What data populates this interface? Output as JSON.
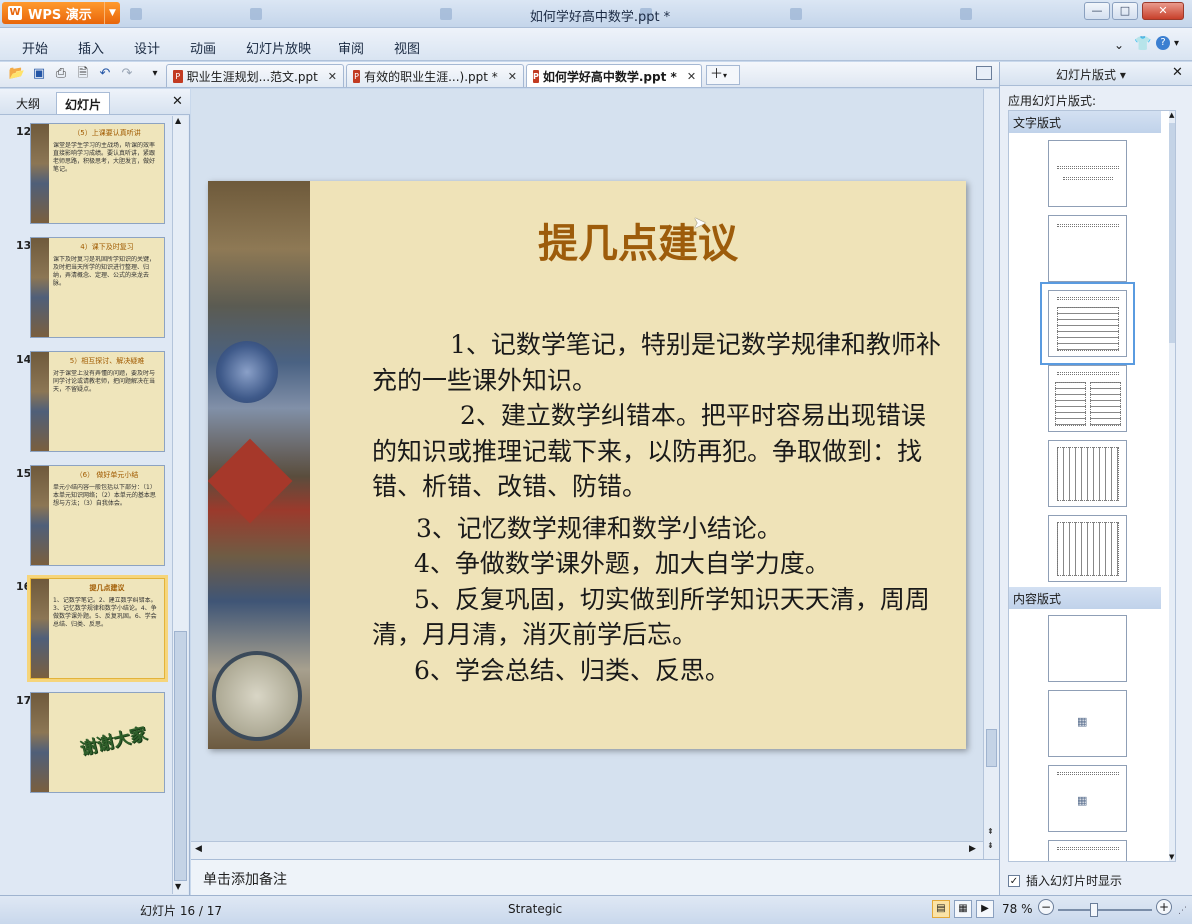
{
  "app": {
    "name": "WPS 演示",
    "window_title": "如何学好高中数学.ppt *"
  },
  "window_controls": {
    "minimize": "—",
    "maximize": "□",
    "close": "✕"
  },
  "menu": [
    "开始",
    "插入",
    "设计",
    "动画",
    "幻灯片放映",
    "审阅",
    "视图"
  ],
  "doc_tabs": [
    {
      "label": "职业生涯规划...范文.ppt",
      "active": false
    },
    {
      "label": "有效的职业生涯...).ppt *",
      "active": false
    },
    {
      "label": "如何学好高中数学.ppt *",
      "active": true
    }
  ],
  "left_panel": {
    "tabs": [
      "大纲",
      "幻灯片"
    ],
    "active_tab": "幻灯片",
    "close": "✕",
    "thumbnails": [
      {
        "num": "12",
        "title": "（5）上课要认真听讲",
        "text": "课堂是学生学习的主战场，听课的效率直接影响学习成绩。要认真听讲，紧跟老师思路，积极思考，大胆发言，做好笔记。"
      },
      {
        "num": "13",
        "title": "4）课下及时复习",
        "text": "课下及时复习是巩固所学知识的关键，及时把当天所学的知识进行整理、归纳，弄清概念、定理、公式的来龙去脉。"
      },
      {
        "num": "14",
        "title": "5）相互探讨、解决疑难",
        "text": "对于课堂上没有弄懂的问题，要及时与同学讨论或请教老师，把问题解决在当天，不留疑点。"
      },
      {
        "num": "15",
        "title": "（6） 做好单元小结",
        "text": "单元小结内容一般包括以下部分：（1）本单元知识网络；（2）本单元的基本思想与方法；（3）自我体会。"
      },
      {
        "num": "16",
        "title": "提几点建议",
        "text": "1、记数学笔记。2、建立数学纠错本。3、记忆数学规律和数学小结论。4、争做数学课外题。5、反复巩固。6、学会总结、归类、反思。",
        "selected": true
      },
      {
        "num": "17",
        "title": "",
        "text": "谢谢大家",
        "art": true
      }
    ]
  },
  "slide": {
    "title": "提几点建议",
    "paragraphs": [
      "1、记数学笔记，特别是记数学规律和教师补充的一些课外知识。",
      "2、建立数学纠错本。把平时容易出现错误的知识或推理记载下来，以防再犯。争取做到：找错、析错、改错、防错。",
      "3、记忆数学规律和数学小结论。",
      "4、争做数学课外题，加大自学力度。",
      "5、反复巩固，切实做到所学知识天天清，周周清，月月清，消灭前学后忘。",
      "6、学会总结、归类、反思。"
    ]
  },
  "notes_placeholder": "单击添加备注",
  "right_pane": {
    "title": "幻灯片版式",
    "apply_label": "应用幻灯片版式:",
    "section_text": "文字版式",
    "section_content": "内容版式",
    "checkbox_label": "插入幻灯片时显示",
    "checkbox_checked": true
  },
  "status": {
    "slide_counter": "幻灯片 16 / 17",
    "theme": "Strategic",
    "zoom": "78 %"
  }
}
